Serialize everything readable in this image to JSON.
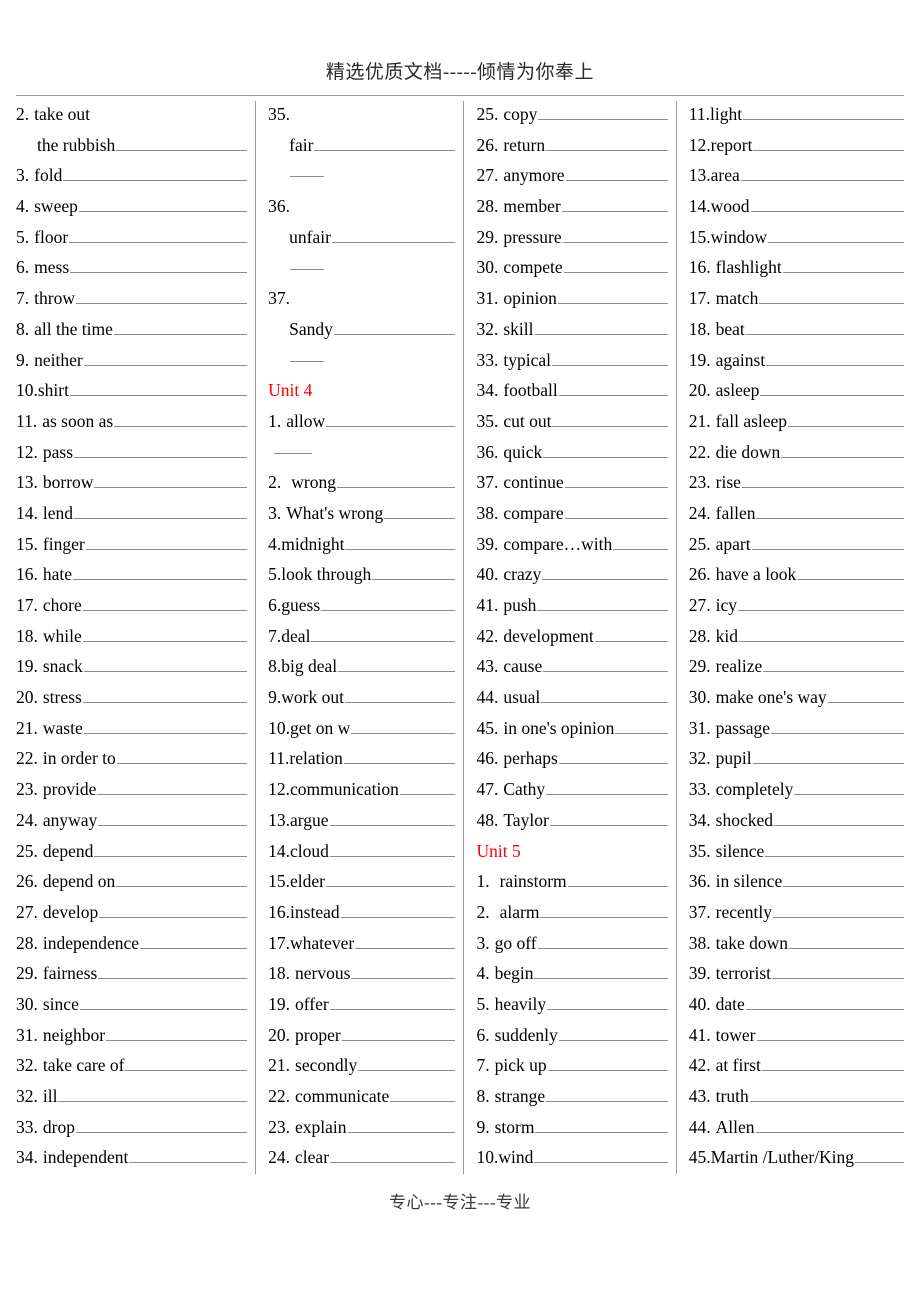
{
  "header": {
    "watermark": "精选优质文档-----倾情为你奉上"
  },
  "footer": {
    "watermark": "专心---专注---专业"
  },
  "colors": {
    "unit_heading": "#ff0000",
    "rule": "#9a9a9a",
    "blank_line": "#8c8c8c",
    "text": "#000000"
  },
  "columns": [
    {
      "id": "column-1",
      "entries": [
        {
          "num": "2.",
          "term": "take out",
          "blank": false,
          "style": "normal"
        },
        {
          "num": "",
          "term": "the rubbish",
          "blank": true,
          "style": "cont"
        },
        {
          "num": "3.",
          "term": "fold",
          "blank": true,
          "style": "normal"
        },
        {
          "num": "4.",
          "term": "sweep",
          "blank": true,
          "style": "normal"
        },
        {
          "num": "5.",
          "term": "floor",
          "blank": true,
          "style": "normal"
        },
        {
          "num": "6.",
          "term": "mess",
          "blank": true,
          "style": "normal"
        },
        {
          "num": "7.",
          "term": "throw",
          "blank": true,
          "style": "normal"
        },
        {
          "num": "8.",
          "term": "all the time",
          "blank": true,
          "style": "normal"
        },
        {
          "num": "9.",
          "term": "neither",
          "blank": true,
          "style": "normal"
        },
        {
          "num": "10.",
          "term": "shirt",
          "blank": true,
          "style": "tight"
        },
        {
          "num": "11.",
          "term": "as soon as",
          "blank": true,
          "style": "normal"
        },
        {
          "num": "12.",
          "term": "pass",
          "blank": true,
          "style": "normal"
        },
        {
          "num": "13.",
          "term": "borrow",
          "blank": true,
          "style": "normal"
        },
        {
          "num": "14.",
          "term": "lend",
          "blank": true,
          "style": "normal"
        },
        {
          "num": "15.",
          "term": "finger",
          "blank": true,
          "style": "normal"
        },
        {
          "num": "16.",
          "term": "hate",
          "blank": true,
          "style": "normal"
        },
        {
          "num": "17.",
          "term": "chore",
          "blank": true,
          "style": "normal"
        },
        {
          "num": "18.",
          "term": "while",
          "blank": true,
          "style": "normal"
        },
        {
          "num": "19.",
          "term": "snack",
          "blank": true,
          "style": "normal"
        },
        {
          "num": "20.",
          "term": "stress",
          "blank": true,
          "style": "normal"
        },
        {
          "num": "21.",
          "term": "waste",
          "blank": true,
          "style": "normal"
        },
        {
          "num": "22.",
          "term": "in order to",
          "blank": true,
          "style": "normal"
        },
        {
          "num": "23.",
          "term": "provide",
          "blank": true,
          "style": "normal"
        },
        {
          "num": "24.",
          "term": "anyway",
          "blank": true,
          "style": "normal"
        },
        {
          "num": "25.",
          "term": "depend",
          "blank": true,
          "style": "normal"
        },
        {
          "num": "26.",
          "term": "depend on",
          "blank": true,
          "style": "normal"
        },
        {
          "num": "27.",
          "term": "develop",
          "blank": true,
          "style": "normal"
        },
        {
          "num": "28.",
          "term": "independence",
          "blank": true,
          "style": "normal"
        },
        {
          "num": "29.",
          "term": "fairness",
          "blank": true,
          "style": "normal"
        },
        {
          "num": "30.",
          "term": "since",
          "blank": true,
          "style": "normal"
        },
        {
          "num": "31.",
          "term": "neighbor",
          "blank": true,
          "style": "normal"
        },
        {
          "num": "32.",
          "term": "take care of",
          "blank": true,
          "style": "normal"
        },
        {
          "num": "32.",
          "term": "ill",
          "blank": true,
          "style": "normal"
        },
        {
          "num": "33.",
          "term": "drop",
          "blank": true,
          "style": "normal"
        },
        {
          "num": "34.",
          "term": "independent",
          "blank": true,
          "style": "normal"
        }
      ]
    },
    {
      "id": "column-2",
      "entries": [
        {
          "num": "35.",
          "term": "",
          "blank": false,
          "style": "normal"
        },
        {
          "num": "",
          "term": "fair",
          "blank": true,
          "style": "cont"
        },
        {
          "num": "",
          "term": "",
          "blank": true,
          "style": "orphan"
        },
        {
          "num": "36.",
          "term": "",
          "blank": false,
          "style": "normal"
        },
        {
          "num": "",
          "term": "unfair",
          "blank": true,
          "style": "cont"
        },
        {
          "num": "",
          "term": "",
          "blank": true,
          "style": "orphan"
        },
        {
          "num": "37.",
          "term": "",
          "blank": false,
          "style": "normal"
        },
        {
          "num": "",
          "term": "Sandy",
          "blank": true,
          "style": "cont"
        },
        {
          "num": "",
          "term": "",
          "blank": true,
          "style": "orphan"
        },
        {
          "unit": "Unit 4"
        },
        {
          "num": "1.",
          "term": "allow",
          "blank": true,
          "style": "normal"
        },
        {
          "num": "",
          "term": "",
          "blank": true,
          "style": "orphan-left"
        },
        {
          "num": "2.",
          "term": "wrong",
          "blank": true,
          "style": "wide-num"
        },
        {
          "num": "3.",
          "term": "What's wrong",
          "blank": true,
          "style": "normal"
        },
        {
          "num": "4.",
          "term": "midnight",
          "blank": true,
          "style": "tight"
        },
        {
          "num": "5.",
          "term": "look through",
          "blank": true,
          "style": "tight"
        },
        {
          "num": "6.",
          "term": "guess",
          "blank": true,
          "style": "tight"
        },
        {
          "num": "7.",
          "term": "deal",
          "blank": true,
          "style": "tight"
        },
        {
          "num": "8.",
          "term": "big deal",
          "blank": true,
          "style": "tight"
        },
        {
          "num": "9.",
          "term": "work out",
          "blank": true,
          "style": "tight"
        },
        {
          "num": "10.",
          "term": "get on w",
          "blank": true,
          "style": "tight"
        },
        {
          "num": "11.",
          "term": "relation",
          "blank": true,
          "style": "tight"
        },
        {
          "num": "12.",
          "term": "communication",
          "blank": true,
          "style": "tight"
        },
        {
          "num": "13.",
          "term": "argue",
          "blank": true,
          "style": "tight"
        },
        {
          "num": "14.",
          "term": "cloud",
          "blank": true,
          "style": "tight"
        },
        {
          "num": "15.",
          "term": "elder",
          "blank": true,
          "style": "tight"
        },
        {
          "num": "16.",
          "term": "instead",
          "blank": true,
          "style": "tight"
        },
        {
          "num": "17.",
          "term": "whatever",
          "blank": true,
          "style": "tight"
        },
        {
          "num": "18.",
          "term": "nervous",
          "blank": true,
          "style": "normal"
        },
        {
          "num": "19.",
          "term": "offer",
          "blank": true,
          "style": "normal"
        },
        {
          "num": "20.",
          "term": "proper",
          "blank": true,
          "style": "normal"
        },
        {
          "num": "21.",
          "term": "secondly",
          "blank": true,
          "style": "normal"
        },
        {
          "num": "22.",
          "term": "communicate",
          "blank": true,
          "style": "normal"
        },
        {
          "num": "23.",
          "term": "explain",
          "blank": true,
          "style": "normal"
        },
        {
          "num": "24.",
          "term": "clear",
          "blank": true,
          "style": "normal"
        }
      ]
    },
    {
      "id": "column-3",
      "entries": [
        {
          "num": "25.",
          "term": "copy",
          "blank": true,
          "style": "normal"
        },
        {
          "num": "26.",
          "term": "return",
          "blank": true,
          "style": "normal"
        },
        {
          "num": "27.",
          "term": "anymore",
          "blank": true,
          "style": "normal"
        },
        {
          "num": "28.",
          "term": "member",
          "blank": true,
          "style": "normal"
        },
        {
          "num": "29.",
          "term": "pressure",
          "blank": true,
          "style": "normal"
        },
        {
          "num": "30.",
          "term": "compete",
          "blank": true,
          "style": "normal"
        },
        {
          "num": "31.",
          "term": "opinion",
          "blank": true,
          "style": "normal"
        },
        {
          "num": "32.",
          "term": "skill",
          "blank": true,
          "style": "normal"
        },
        {
          "num": "33.",
          "term": "typical",
          "blank": true,
          "style": "normal"
        },
        {
          "num": "34.",
          "term": "football",
          "blank": true,
          "style": "normal"
        },
        {
          "num": "35.",
          "term": "cut out",
          "blank": true,
          "style": "normal"
        },
        {
          "num": "36.",
          "term": "quick",
          "blank": true,
          "style": "normal"
        },
        {
          "num": "37.",
          "term": "continue",
          "blank": true,
          "style": "normal"
        },
        {
          "num": "38.",
          "term": "compare",
          "blank": true,
          "style": "normal"
        },
        {
          "num": "39.",
          "term": "compare…with",
          "blank": true,
          "style": "normal"
        },
        {
          "num": "40.",
          "term": "crazy",
          "blank": true,
          "style": "normal"
        },
        {
          "num": "41.",
          "term": "push",
          "blank": true,
          "style": "normal"
        },
        {
          "num": "42.",
          "term": "development",
          "blank": true,
          "style": "normal"
        },
        {
          "num": "43.",
          "term": "cause",
          "blank": true,
          "style": "normal"
        },
        {
          "num": "44.",
          "term": "usual",
          "blank": true,
          "style": "normal"
        },
        {
          "num": "45.",
          "term": "in one's opinion",
          "blank": true,
          "style": "normal"
        },
        {
          "num": "46.",
          "term": "perhaps",
          "blank": true,
          "style": "normal"
        },
        {
          "num": "47.",
          "term": "Cathy",
          "blank": true,
          "style": "normal"
        },
        {
          "num": "48.",
          "term": "Taylor",
          "blank": true,
          "style": "normal"
        },
        {
          "unit": "Unit  5"
        },
        {
          "num": "1.",
          "term": "rainstorm",
          "blank": true,
          "style": "wide-num"
        },
        {
          "num": "2.",
          "term": "alarm",
          "blank": true,
          "style": "wide-num"
        },
        {
          "num": "3.",
          "term": "go off",
          "blank": true,
          "style": "normal"
        },
        {
          "num": "4.",
          "term": "begin",
          "blank": true,
          "style": "normal"
        },
        {
          "num": "5.",
          "term": "heavily",
          "blank": true,
          "style": "normal"
        },
        {
          "num": "6.",
          "term": "suddenly",
          "blank": true,
          "style": "normal"
        },
        {
          "num": "7.",
          "term": "pick up",
          "blank": true,
          "style": "normal"
        },
        {
          "num": "8.",
          "term": "strange",
          "blank": true,
          "style": "normal"
        },
        {
          "num": "9.",
          "term": "storm",
          "blank": true,
          "style": "normal"
        },
        {
          "num": "10.",
          "term": "wind",
          "blank": true,
          "style": "tight"
        }
      ]
    },
    {
      "id": "column-4",
      "entries": [
        {
          "num": "11.",
          "term": "light",
          "blank": true,
          "style": "tight"
        },
        {
          "num": "12.",
          "term": "report",
          "blank": true,
          "style": "tight"
        },
        {
          "num": "13.",
          "term": "area",
          "blank": true,
          "style": "tight"
        },
        {
          "num": "14.",
          "term": "wood",
          "blank": true,
          "style": "tight"
        },
        {
          "num": "15.",
          "term": "window",
          "blank": true,
          "style": "tight"
        },
        {
          "num": "16.",
          "term": "flashlight",
          "blank": true,
          "style": "normal"
        },
        {
          "num": "17.",
          "term": "match",
          "blank": true,
          "style": "normal"
        },
        {
          "num": "18.",
          "term": "beat",
          "blank": true,
          "style": "normal"
        },
        {
          "num": "19.",
          "term": "against",
          "blank": true,
          "style": "normal"
        },
        {
          "num": "20.",
          "term": "asleep",
          "blank": true,
          "style": "normal"
        },
        {
          "num": "21.",
          "term": "fall asleep",
          "blank": true,
          "style": "normal"
        },
        {
          "num": "22.",
          "term": "die down",
          "blank": true,
          "style": "normal"
        },
        {
          "num": "23.",
          "term": "rise",
          "blank": true,
          "style": "normal"
        },
        {
          "num": "24.",
          "term": "fallen",
          "blank": true,
          "style": "normal"
        },
        {
          "num": "25.",
          "term": "apart",
          "blank": true,
          "style": "normal"
        },
        {
          "num": "26.",
          "term": "have a look",
          "blank": true,
          "style": "normal"
        },
        {
          "num": "27.",
          "term": "icy",
          "blank": true,
          "style": "normal"
        },
        {
          "num": "28.",
          "term": "kid",
          "blank": true,
          "style": "normal"
        },
        {
          "num": "29.",
          "term": "realize",
          "blank": true,
          "style": "normal"
        },
        {
          "num": "30.",
          "term": "make one's way",
          "blank": true,
          "style": "normal"
        },
        {
          "num": "31.",
          "term": "passage",
          "blank": true,
          "style": "normal"
        },
        {
          "num": "32.",
          "term": "pupil",
          "blank": true,
          "style": "normal"
        },
        {
          "num": "33.",
          "term": "completely",
          "blank": true,
          "style": "normal"
        },
        {
          "num": "34.",
          "term": "shocked",
          "blank": true,
          "style": "normal"
        },
        {
          "num": "35.",
          "term": "silence",
          "blank": true,
          "style": "normal"
        },
        {
          "num": "36.",
          "term": "in silence",
          "blank": true,
          "style": "normal"
        },
        {
          "num": "37.",
          "term": "recently",
          "blank": true,
          "style": "normal"
        },
        {
          "num": "38.",
          "term": "take down",
          "blank": true,
          "style": "normal"
        },
        {
          "num": "39.",
          "term": "terrorist",
          "blank": true,
          "style": "normal"
        },
        {
          "num": "40.",
          "term": "date",
          "blank": true,
          "style": "normal"
        },
        {
          "num": "41.",
          "term": "tower",
          "blank": true,
          "style": "normal"
        },
        {
          "num": "42.",
          "term": "at first",
          "blank": true,
          "style": "normal"
        },
        {
          "num": "43.",
          "term": "truth",
          "blank": true,
          "style": "normal"
        },
        {
          "num": "44.",
          "term": "Allen",
          "blank": true,
          "style": "normal"
        },
        {
          "num": "45.",
          "term": "Martin /Luther/King",
          "blank": true,
          "style": "tight"
        }
      ]
    }
  ]
}
